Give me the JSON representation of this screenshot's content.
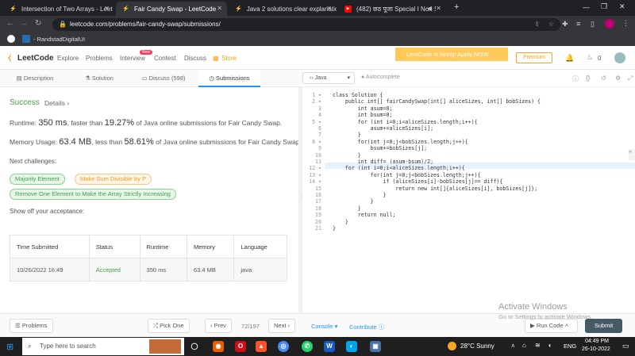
{
  "browser": {
    "tabs": [
      {
        "title": "Intersection of Two Arrays - Leet",
        "active": false
      },
      {
        "title": "Fair Candy Swap - LeetCode",
        "active": true
      },
      {
        "title": "Java 2 solutions clear explanation",
        "active": false
      },
      {
        "title": "(482) छठ पूजा Special I Non S",
        "active": false
      }
    ],
    "new_tab": "+",
    "url": "leetcode.com/problems/fair-candy-swap/submissions/",
    "bookmark": "- RandstadDigitalUI"
  },
  "nav": {
    "logo": "LeetCode",
    "links": [
      "Explore",
      "Problems",
      "Interview",
      "Contest",
      "Discuss",
      "Store"
    ],
    "new_badge": "New",
    "hiring": "LeetCode is hiring! Apply NOW.",
    "premium": "Premium",
    "coins": "0"
  },
  "subtabs": [
    "Description",
    "Solution",
    "Discuss (598)",
    "Submissions"
  ],
  "editor_toolbar": {
    "language": "Java",
    "autocomplete": "Autocomplete"
  },
  "result": {
    "status": "Success",
    "details": "Details",
    "runtime_label": "Runtime:",
    "runtime_value": "350 ms",
    "runtime_mid": ", faster than",
    "runtime_pct": "19.27%",
    "runtime_tail": "of Java online submissions for Fair Candy Swap.",
    "memory_label": "Memory Usage:",
    "memory_value": "63.4 MB",
    "memory_mid": ", less than",
    "memory_pct": "58.61%",
    "memory_tail": "of Java online submissions for Fair Candy Swap.",
    "next_label": "Next challenges:",
    "challenges": [
      "Majority Element",
      "Make Sum Divisible by P",
      "Remove One Element to Make the Array Strictly Increasing"
    ],
    "show_off": "Show off your acceptance:"
  },
  "table": {
    "headers": [
      "Time Submitted",
      "Status",
      "Runtime",
      "Memory",
      "Language"
    ],
    "row": [
      "10/26/2022 16:49",
      "Accepted",
      "350 ms",
      "63.4 MB",
      "java"
    ]
  },
  "code_lines": [
    "class Solution {",
    "    public int[] fairCandySwap(int[] aliceSizes, int[] bobSizes) {",
    "        int asum=0;",
    "        int bsum=0;",
    "        for (int i=0;i<aliceSizes.length;i++){",
    "            asum+=aliceSizes[i];",
    "        }",
    "        for(int j=0;j<bobSizes.length;j++){",
    "            bsum+=bobSizes[j];",
    "        }",
    "        int diff= (asum-bsum)/2;",
    "    for (int i=0;i<aliceSizes.length;i++){",
    "            for(int j=0;j<bobSizes.length;j++){",
    "                if (aliceSizes[i]-bobSizes[j]== diff){",
    "                    return new int[]{aliceSizes[i], bobSizes[j]};",
    "                }",
    "            }",
    "        }",
    "        return null;",
    "    }",
    "}"
  ],
  "bottom": {
    "problems": "Problems",
    "pick_one": "Pick One",
    "prev": "Prev",
    "pager": "72/197",
    "next": "Next",
    "console": "Console",
    "contribute": "Contribute",
    "run": "Run Code",
    "submit": "Submit"
  },
  "watermark": {
    "title": "Activate Windows",
    "sub": "Go to Settings to activate Windows."
  },
  "taskbar": {
    "search": "Type here to search",
    "weather": "28°C  Sunny",
    "lang": "ENG",
    "time": "04:49 PM",
    "date": "26-10-2022"
  },
  "colors": {
    "accent": "#2196f3",
    "success": "#43a047",
    "hiring_bg": "#ffc95c",
    "submit_bg": "#455a64"
  }
}
